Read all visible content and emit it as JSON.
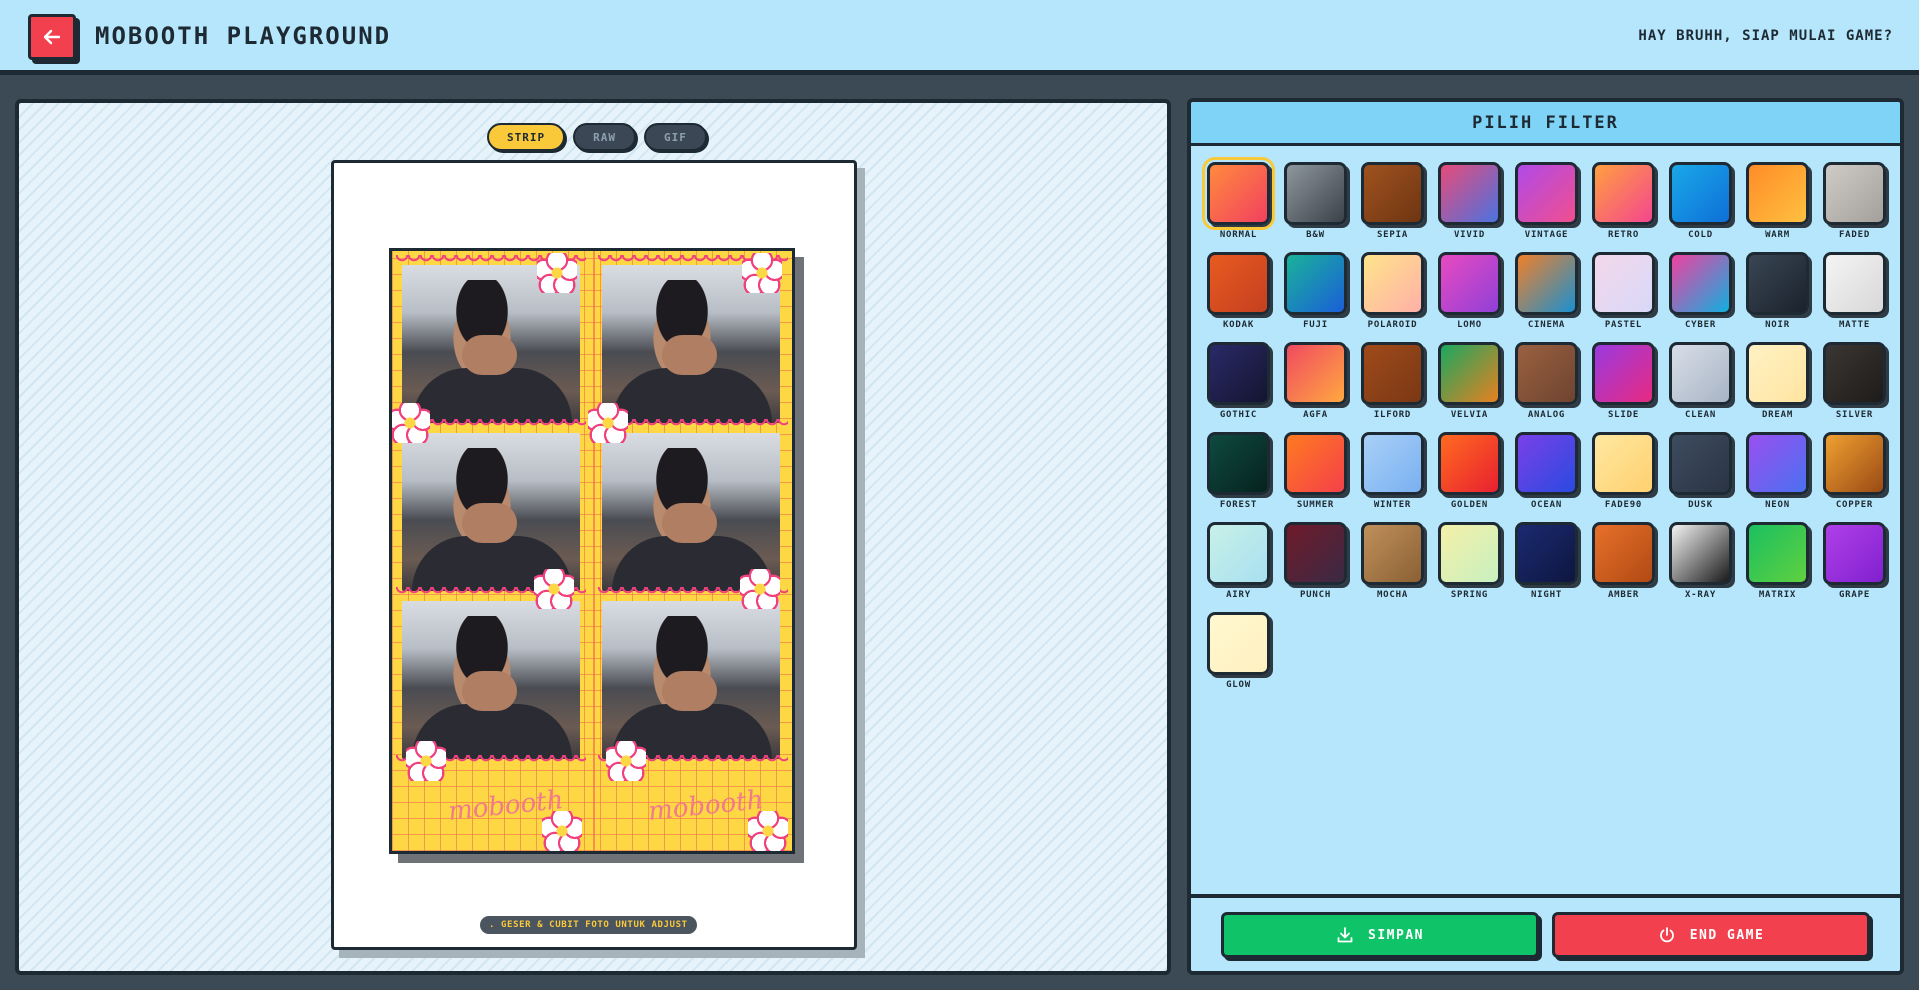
{
  "header": {
    "title": "MOBOOTH PLAYGROUND",
    "greeting": "HAY BRUHH, SIAP MULAI GAME?"
  },
  "preview": {
    "tabs": [
      {
        "label": "STRIP",
        "active": true
      },
      {
        "label": "RAW",
        "active": false
      },
      {
        "label": "GIF",
        "active": false
      }
    ],
    "brand_text": "mobooth",
    "hint": ". GESER & CUBIT FOTO UNTUK ADJUST"
  },
  "filters": {
    "title": "PILIH FILTER",
    "selected": "NORMAL",
    "items": [
      {
        "label": "NORMAL",
        "colors": [
          "#ff8a3d",
          "#f2405f"
        ]
      },
      {
        "label": "B&W",
        "colors": [
          "#8e969e",
          "#3b4249"
        ]
      },
      {
        "label": "SEPIA",
        "colors": [
          "#a0521e",
          "#6e3512"
        ]
      },
      {
        "label": "VIVID",
        "colors": [
          "#e84a7a",
          "#4a73e0"
        ]
      },
      {
        "label": "VINTAGE",
        "colors": [
          "#b049e8",
          "#f04f8e"
        ]
      },
      {
        "label": "RETRO",
        "colors": [
          "#ff9f40",
          "#f4468e"
        ]
      },
      {
        "label": "COLD",
        "colors": [
          "#1aa8e8",
          "#0e6fd8"
        ]
      },
      {
        "label": "WARM",
        "colors": [
          "#ff8c28",
          "#ffc040"
        ]
      },
      {
        "label": "FADED",
        "colors": [
          "#cfcbc6",
          "#a39f9b"
        ]
      },
      {
        "label": "KODAK",
        "colors": [
          "#e85a20",
          "#c44020"
        ]
      },
      {
        "label": "FUJI",
        "colors": [
          "#1ab39a",
          "#1a5ed8"
        ]
      },
      {
        "label": "POLAROID",
        "colors": [
          "#ffe48a",
          "#ffb0a8"
        ]
      },
      {
        "label": "LOMO",
        "colors": [
          "#e84ac0",
          "#9040d8"
        ]
      },
      {
        "label": "CINEMA",
        "colors": [
          "#f0802a",
          "#1a90d0"
        ]
      },
      {
        "label": "PASTEL",
        "colors": [
          "#f4d8ea",
          "#d8d8f8"
        ]
      },
      {
        "label": "CYBER",
        "colors": [
          "#f040a0",
          "#10b0e0"
        ]
      },
      {
        "label": "NOIR",
        "colors": [
          "#3a4654",
          "#1a222c"
        ]
      },
      {
        "label": "MATTE",
        "colors": [
          "#f4f4f4",
          "#d8d8d8"
        ]
      },
      {
        "label": "GOTHIC",
        "colors": [
          "#2a2a68",
          "#141430"
        ]
      },
      {
        "label": "AGFA",
        "colors": [
          "#f04a60",
          "#ffa840"
        ]
      },
      {
        "label": "ILFORD",
        "colors": [
          "#a04a1a",
          "#7a3814"
        ]
      },
      {
        "label": "VELVIA",
        "colors": [
          "#1aa860",
          "#e88020"
        ]
      },
      {
        "label": "ANALOG",
        "colors": [
          "#9a6040",
          "#6e4430"
        ]
      },
      {
        "label": "SLIDE",
        "colors": [
          "#9a3ae0",
          "#e82a80"
        ]
      },
      {
        "label": "CLEAN",
        "colors": [
          "#d8dee8",
          "#a8b4c4"
        ]
      },
      {
        "label": "DREAM",
        "colors": [
          "#fff2c4",
          "#ffe4a0"
        ]
      },
      {
        "label": "SILVER",
        "colors": [
          "#3a3634",
          "#1e1c1a"
        ]
      },
      {
        "label": "FOREST",
        "colors": [
          "#0e4a40",
          "#06221e"
        ]
      },
      {
        "label": "SUMMER",
        "colors": [
          "#ff7a20",
          "#f4404a"
        ]
      },
      {
        "label": "WINTER",
        "colors": [
          "#a8d0f8",
          "#7ab0f0"
        ]
      },
      {
        "label": "GOLDEN",
        "colors": [
          "#ff6a20",
          "#e82030"
        ]
      },
      {
        "label": "OCEAN",
        "colors": [
          "#7a40e8",
          "#2a4ae0"
        ]
      },
      {
        "label": "FADE90",
        "colors": [
          "#ffe8a0",
          "#ffd070"
        ]
      },
      {
        "label": "DUSK",
        "colors": [
          "#3e4c60",
          "#2a3444"
        ]
      },
      {
        "label": "NEON",
        "colors": [
          "#9a50f0",
          "#4a70f0"
        ]
      },
      {
        "label": "COPPER",
        "colors": [
          "#f0a030",
          "#9a4a14"
        ]
      },
      {
        "label": "AIRY",
        "colors": [
          "#c8f0e8",
          "#a8e0f0"
        ]
      },
      {
        "label": "PUNCH",
        "colors": [
          "#701a2a",
          "#3a2a44"
        ]
      },
      {
        "label": "MOCHA",
        "colors": [
          "#c0905a",
          "#8a6034"
        ]
      },
      {
        "label": "SPRING",
        "colors": [
          "#f4f0a8",
          "#c8f0c0"
        ]
      },
      {
        "label": "NIGHT",
        "colors": [
          "#1a2a70",
          "#0e1640"
        ]
      },
      {
        "label": "AMBER",
        "colors": [
          "#e8702a",
          "#b04a14"
        ]
      },
      {
        "label": "X-RAY",
        "colors": [
          "#f4f4f4",
          "#1a1a1a"
        ]
      },
      {
        "label": "MATRIX",
        "colors": [
          "#1ac060",
          "#60d040"
        ]
      },
      {
        "label": "GRAPE",
        "colors": [
          "#b040e8",
          "#8020d0"
        ]
      },
      {
        "label": "GLOW",
        "colors": [
          "#fff8d0",
          "#fff0c0"
        ]
      }
    ]
  },
  "actions": {
    "save_label": "SIMPAN",
    "end_label": "END GAME"
  },
  "colors": {
    "accent_yellow": "#f9c93a",
    "header_bg": "#b5e6fb",
    "danger": "#f2404f",
    "success": "#0fc468",
    "ink": "#1e2a33"
  }
}
